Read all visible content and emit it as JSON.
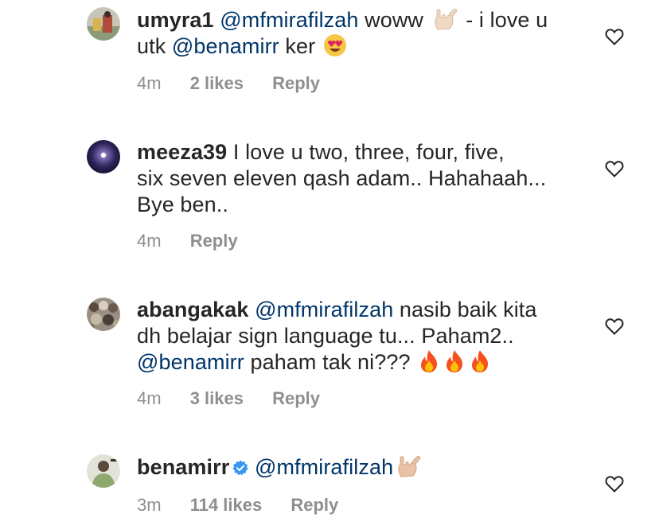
{
  "comments": [
    {
      "username": "umyra1",
      "line1_mention": "@mfmirafilzah",
      "line1_text": " woww ",
      "line1_after": " - i love u",
      "line2_prefix": "utk ",
      "line2_mention": "@benamirr",
      "line2_text": " ker ",
      "time": "4m",
      "likes": "2 likes",
      "reply": "Reply",
      "emojis": [
        "sign-of-horns-emoji",
        "heart-eyes-emoji"
      ]
    },
    {
      "username": "meeza39",
      "line1_text": " I love u two,  three,  four,  five,",
      "line2_text": "six seven eleven qash adam.. Hahahaah...",
      "line3_text": "Bye ben..",
      "time": "4m",
      "reply": "Reply"
    },
    {
      "username": "abangakak",
      "line1_mention": "@mfmirafilzah",
      "line1_text": " nasib baik kita",
      "line2_text": "dh belajar sign language tu... Paham2..",
      "line3_mention": "@benamirr",
      "line3_text": " paham tak ni??? ",
      "time": "4m",
      "likes": "3 likes",
      "reply": "Reply",
      "emojis": [
        "fire-emoji",
        "fire-emoji",
        "fire-emoji"
      ]
    },
    {
      "username": "benamirr",
      "line1_mention": "@mfmirafilzah",
      "time": "3m",
      "likes": "114 likes",
      "reply": "Reply",
      "verified": true,
      "emojis": [
        "sign-of-horns-emoji"
      ]
    }
  ],
  "colors": {
    "text": "#262626",
    "mention": "#003569",
    "meta": "#8e8e8e",
    "verified": "#3897f0"
  }
}
